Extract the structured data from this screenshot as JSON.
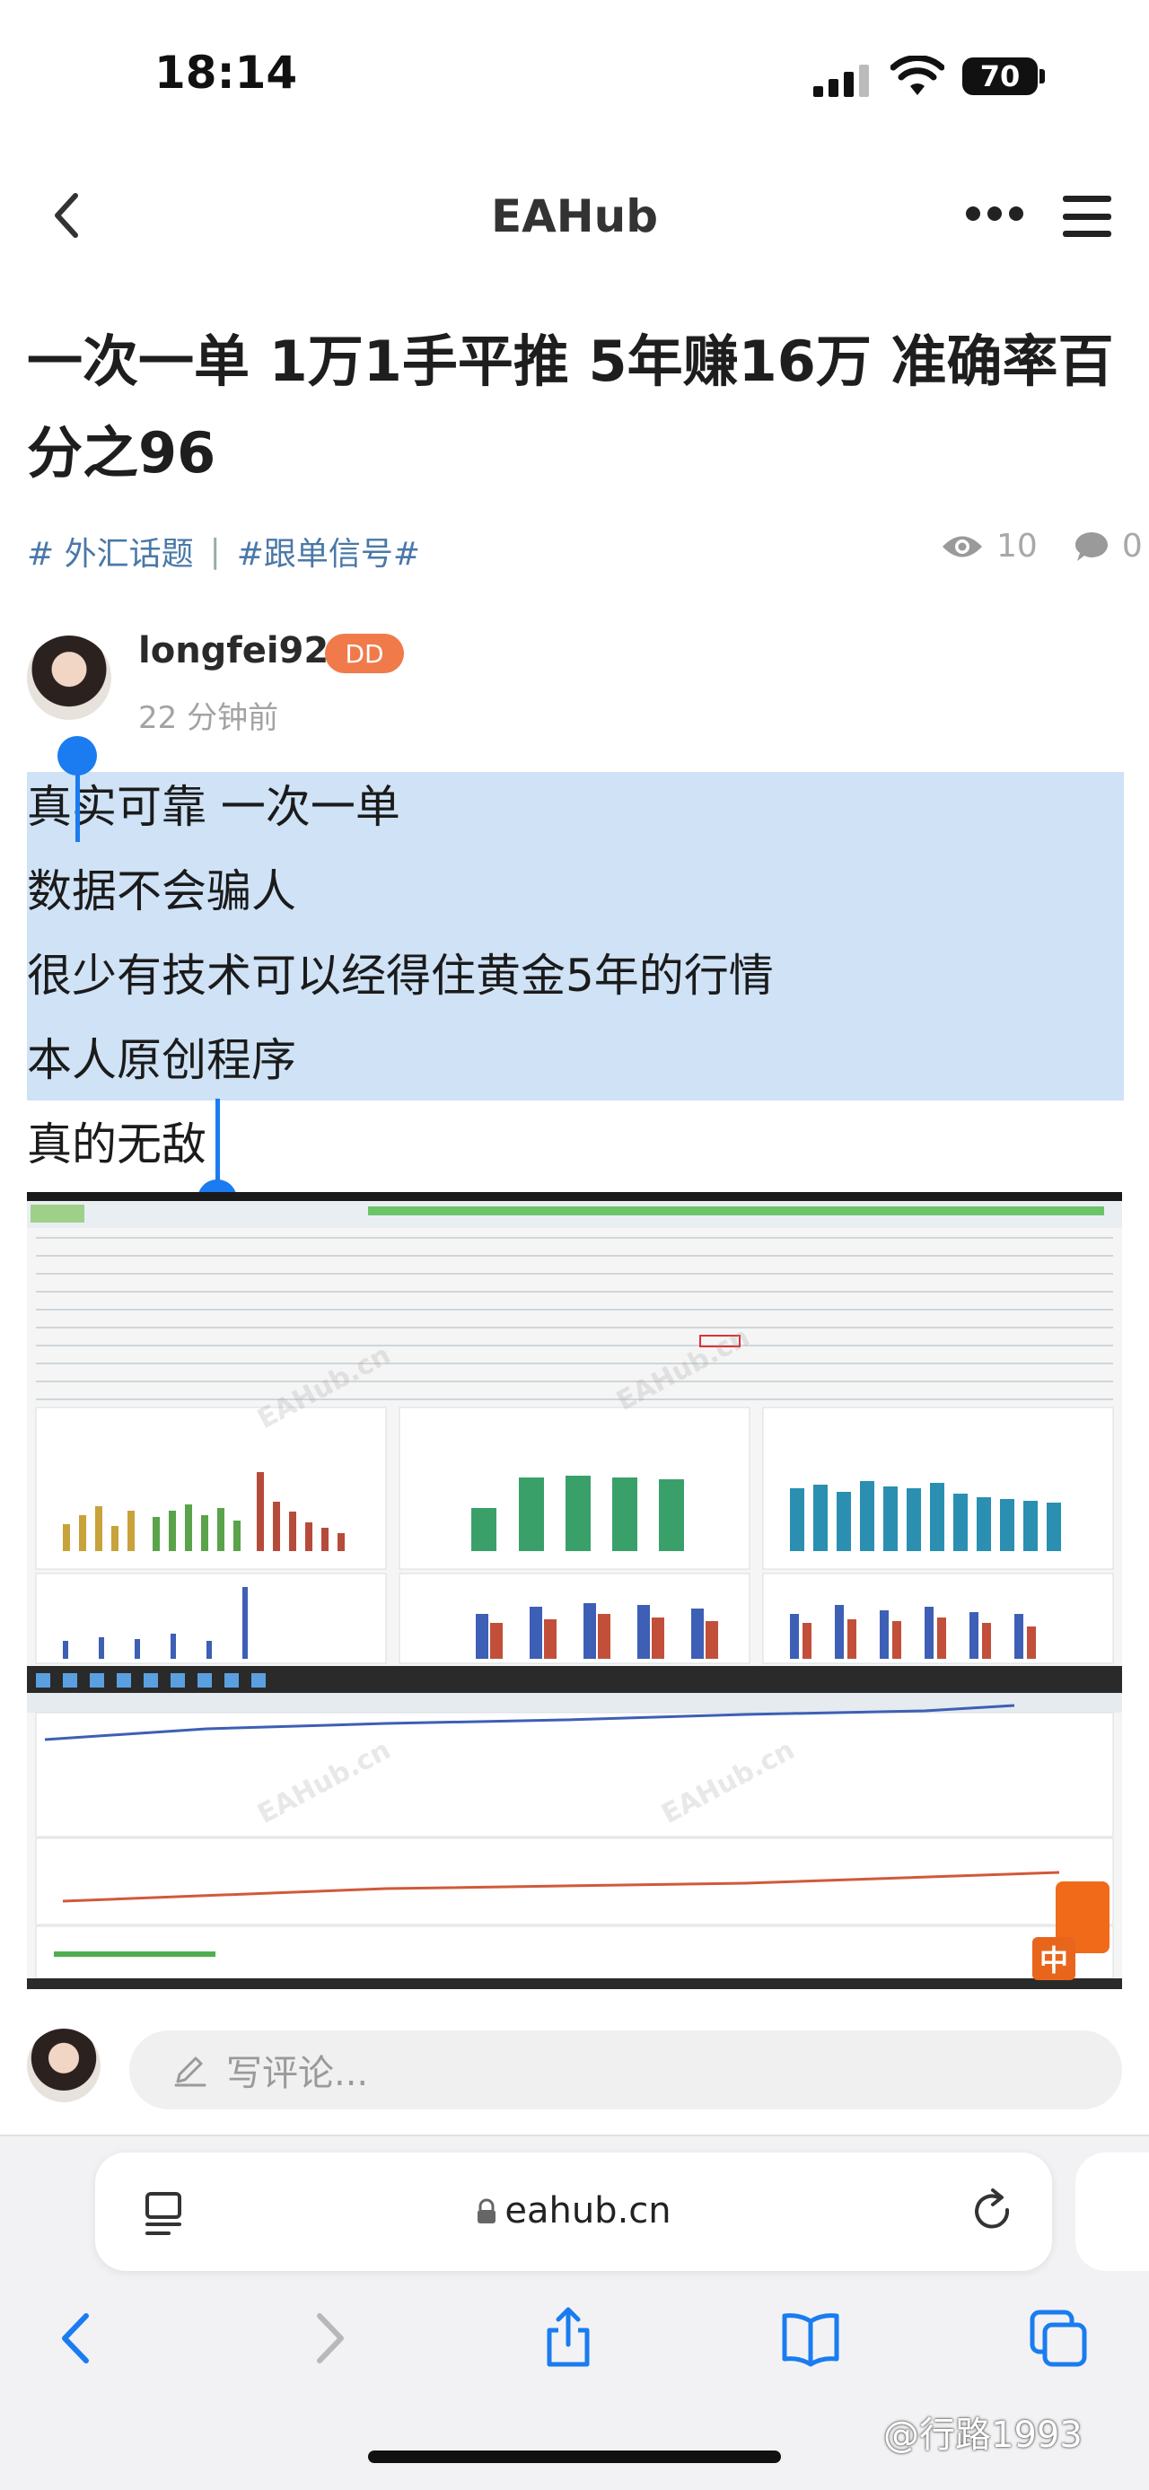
{
  "status_bar": {
    "time": "18:14",
    "battery": "70"
  },
  "nav": {
    "site_title": "EAHub"
  },
  "post": {
    "title": "一次一单 1万1手平推 5年赚16万 准确率百分之96",
    "tags": [
      "# 外汇话题",
      "#跟单信号#"
    ],
    "tag_separator": "|",
    "views": "10",
    "comments": "0",
    "author": "longfei92",
    "badge": "DD",
    "time_ago": "22 分钟前",
    "body_lines": [
      "真实可靠 一次一单",
      "数据不会骗人",
      "很少有技术可以经得住黄金5年的行情",
      "本人原创程序",
      "真的无敌"
    ]
  },
  "screenshot": {
    "watermark": "EAHub.cn",
    "corner_badge": "中"
  },
  "comment_bar": {
    "placeholder": "写评论..."
  },
  "safari": {
    "url": "eahub.cn"
  },
  "overlay": {
    "watermark": "@行路1993"
  },
  "colors": {
    "accent_blue": "#1a7cf0",
    "selection": "#cfe2f6",
    "badge_orange": "#f07a4a",
    "tag_blue": "#4a78a8"
  }
}
